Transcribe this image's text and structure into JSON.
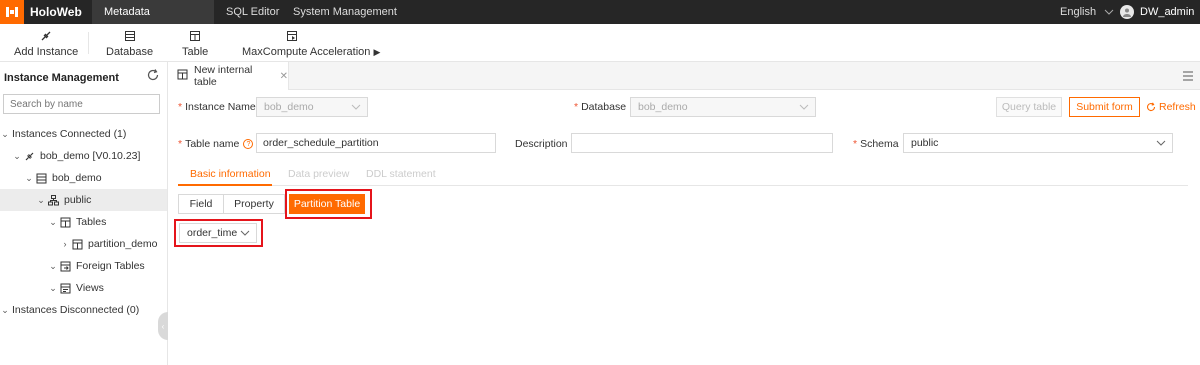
{
  "app": {
    "name": "HoloWeb"
  },
  "topnav": [
    {
      "label": "Metadata Management",
      "active": true
    },
    {
      "label": "SQL Editor",
      "active": false
    },
    {
      "label": "System Management",
      "active": false
    }
  ],
  "header": {
    "language": "English",
    "user": "DW_admin"
  },
  "toolbar": {
    "add_instance": "Add Instance",
    "database": "Database",
    "table": "Table",
    "maxcompute": "MaxCompute Acceleration"
  },
  "sidebar": {
    "title": "Instance Management",
    "search_placeholder": "Search by name",
    "tree": {
      "connected": "Instances Connected (1)",
      "instance": "bob_demo [V0.10.23]",
      "database": "bob_demo",
      "schema": "public",
      "tables": "Tables",
      "table_item": "partition_demo",
      "foreign_tables": "Foreign Tables",
      "views": "Views",
      "disconnected": "Instances Disconnected (0)"
    }
  },
  "tab": {
    "label": "New internal table"
  },
  "form": {
    "instance_label": "Instance Name",
    "instance_value": "bob_demo",
    "database_label": "Database",
    "database_value": "bob_demo",
    "query_table": "Query table",
    "submit_form": "Submit form",
    "refresh": "Refresh",
    "table_name_label": "Table name",
    "table_name_value": "order_schedule_partition",
    "description_label": "Description",
    "description_value": "",
    "schema_label": "Schema",
    "schema_value": "public"
  },
  "subtabs": {
    "basic": "Basic information",
    "preview": "Data preview",
    "ddl": "DDL statement"
  },
  "segments": {
    "field": "Field",
    "property": "Property",
    "partition": "Partition Table"
  },
  "partition_select": {
    "value": "order_time"
  },
  "colors": {
    "accent": "#ff6a00",
    "topbar": "#262626",
    "highlight": "#e5141b"
  }
}
